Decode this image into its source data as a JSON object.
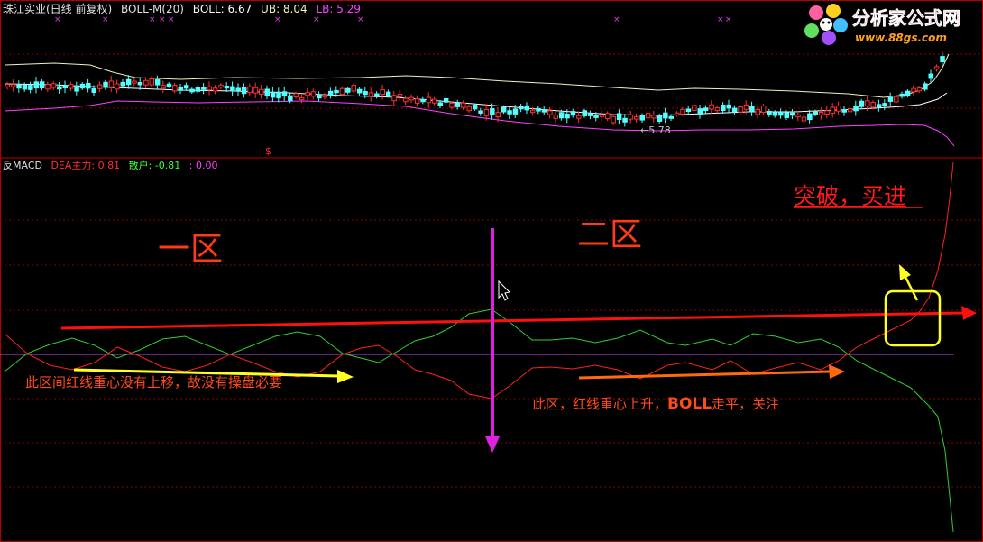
{
  "chart_data": [
    {
      "type": "candlestick",
      "header": {
        "stock": "珠江实业(日线 前复权)",
        "indicator": "BOLL-M(20)",
        "boll_label": "BOLL: 6.67",
        "ub_label": "UB: 8.04",
        "lb_label": "LB: 5.29"
      },
      "low_annotation": "←5.78",
      "marker_glyph": "$",
      "colors": {
        "up": "#ff3030",
        "down": "#54ffff",
        "mid": "#ffffff",
        "ub": "#f0f0c0",
        "lb": "#ff40ff"
      }
    },
    {
      "type": "line",
      "header": {
        "name": "反MACD",
        "dea": "DEA主力: 0.81",
        "retail": "散户: -0.81",
        "third": ": 0.00"
      },
      "series": [
        {
          "name": "DEA主力",
          "color": "#ff2020"
        },
        {
          "name": "散户",
          "color": "#40ff40"
        }
      ]
    }
  ],
  "annotations": {
    "zone1": "一区",
    "zone2": "二区",
    "breakout": "突破，买进",
    "note1": "此区间红线重心没有上移，故没有操盘必要",
    "note2_prefix": "此区，红线重心上升，",
    "note2_boll": "BOLL",
    "note2_suffix": "走平，关注"
  },
  "logo": {
    "text": "分析家公式网",
    "url": "www.88gs.com"
  }
}
